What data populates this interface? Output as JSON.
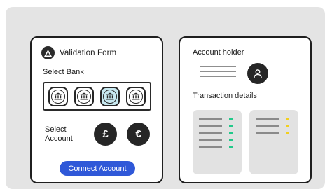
{
  "form": {
    "title": "Validation Form",
    "select_bank_label": "Select Bank",
    "banks": [
      {
        "icon": "bank-icon",
        "selected": false
      },
      {
        "icon": "bank-icon",
        "selected": false
      },
      {
        "icon": "bank-icon",
        "selected": true
      },
      {
        "icon": "bank-icon",
        "selected": false
      }
    ],
    "select_account_label": "Select Account",
    "currencies": [
      "£",
      "€"
    ],
    "connect_label": "Connect Account"
  },
  "summary": {
    "holder_label": "Account holder",
    "transactions_label": "Transaction details"
  },
  "colors": {
    "accent": "#2f58d8",
    "selected_bank": "#c8e9f1",
    "credit": "#22c98a",
    "pending": "#f2cf1d",
    "dark": "#262626"
  }
}
